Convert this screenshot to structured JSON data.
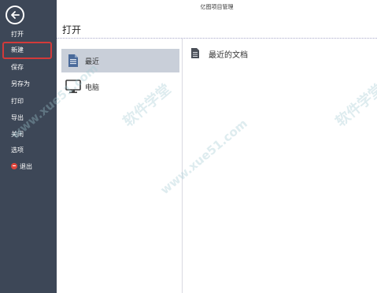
{
  "app": {
    "title": "亿图项目管理"
  },
  "sidebar": {
    "items": [
      {
        "label": "打开"
      },
      {
        "label": "新建"
      },
      {
        "label": "保存"
      },
      {
        "label": "另存为"
      },
      {
        "label": "打印"
      },
      {
        "label": "导出"
      },
      {
        "label": "关闭"
      },
      {
        "label": "选项"
      },
      {
        "label": "退出"
      }
    ],
    "selected": "新建"
  },
  "page": {
    "title": "打开"
  },
  "locations": [
    {
      "label": "最近",
      "icon": "recent-doc-icon",
      "selected": true
    },
    {
      "label": "电脑",
      "icon": "monitor-icon",
      "selected": false
    }
  ],
  "recent": {
    "header": "最近的文档",
    "icon": "document-icon"
  },
  "watermark": {
    "text1": "软件学堂",
    "text2": "www.xue51.com"
  },
  "colors": {
    "sidebar": "#3d4757",
    "highlight_border": "#d23a3a",
    "selected_row": "#c9cfd9"
  }
}
